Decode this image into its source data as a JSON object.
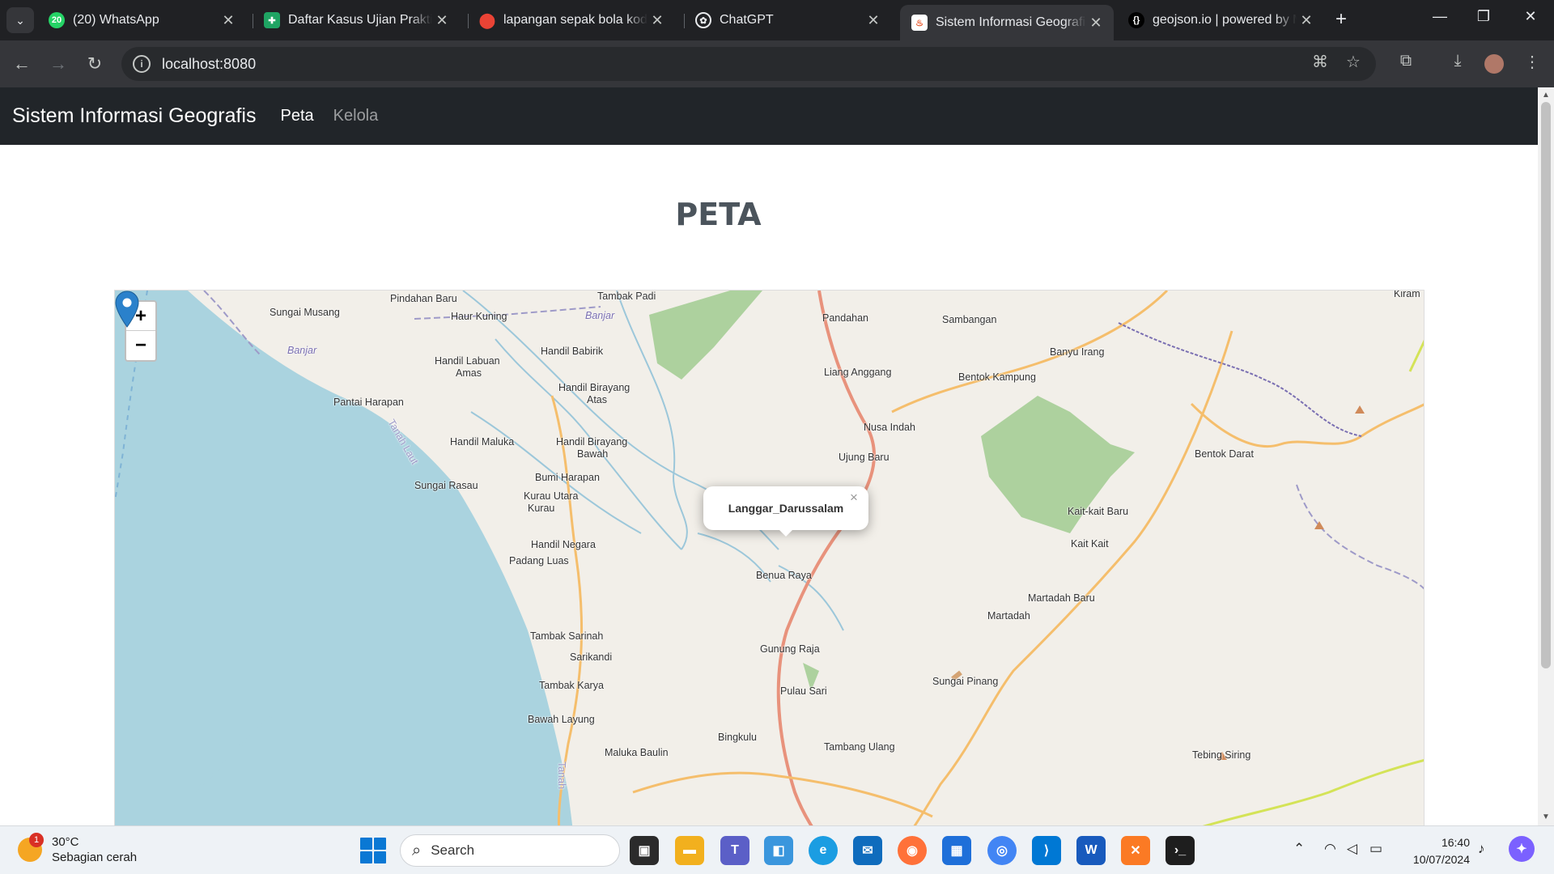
{
  "browser": {
    "tabs": [
      {
        "title": "(20) WhatsApp",
        "icon": "whatsapp-icon",
        "badge": "20"
      },
      {
        "title": "Daftar Kasus Ujian Praktikum",
        "icon": "google-sheets-icon"
      },
      {
        "title": "lapangan sepak bola koding",
        "icon": "google-maps-pin-icon"
      },
      {
        "title": "ChatGPT",
        "icon": "chatgpt-icon"
      },
      {
        "title": "Sistem Informasi Geografis",
        "icon": "page-flame-icon"
      },
      {
        "title": "geojson.io | powered by Mapbox",
        "icon": "geojson-icon",
        "icon_text": "{}"
      }
    ],
    "active_tab_index": 4,
    "url": "localhost:8080"
  },
  "app": {
    "brand": "Sistem Informasi Geografis",
    "nav": [
      {
        "label": "Peta",
        "active": true
      },
      {
        "label": "Kelola",
        "active": false
      }
    ],
    "heading": "PETA"
  },
  "map": {
    "zoom_in": "+",
    "zoom_out": "−",
    "popup_text": "Langgar_Darussalam",
    "popup_close": "×",
    "marker_color": "#2a81cb",
    "labels": [
      "Pindahan Baru",
      "Tambak Padi",
      "Sungai Musang",
      "Haur Kuning",
      "Banjar",
      "Pandahan",
      "Sambangan",
      "Kiram",
      "Banjar",
      "Handil Babirik",
      "Handil Labuan",
      "Amas",
      "Liang Anggang",
      "Banyu Irang",
      "Bentok Kampung",
      "Pantai Harapan",
      "Handil Birayang",
      "Atas",
      "Tanah Laut",
      "Nusa Indah",
      "Handil Maluka",
      "Handil Birayang",
      "Bawah",
      "Ujung Baru",
      "Bentok Darat",
      "Bumi Harapan",
      "Sungai Rasau",
      "Kurau Utara",
      "Kurau",
      "Kait-kait Baru",
      "Handil Negara",
      "Padang Luas",
      "Kait Kait",
      "Benua Raya",
      "Martadah Baru",
      "Martadah",
      "Tambak Sarinah",
      "Sarikandi",
      "Gunung Raja",
      "Tambak Karya",
      "Sungai Pinang",
      "Pulau Sari",
      "Bawah Layung",
      "Bingkulu",
      "Maluka Baulin",
      "Tambang Ulang",
      "Tebing Siring",
      "Tanah"
    ],
    "colors": {
      "water": "#aad3df",
      "land": "#f2efe9",
      "park": "#add19e",
      "main_road": "#e8927c",
      "secondary_road": "#f5be6c",
      "river": "#9cc7da",
      "boundary": "#9e9ac8"
    }
  },
  "taskbar": {
    "weather_temp": "30°C",
    "weather_desc": "Sebagian cerah",
    "weather_badge": "1",
    "search_placeholder": "Search",
    "time": "16:40",
    "date": "10/07/2024"
  }
}
